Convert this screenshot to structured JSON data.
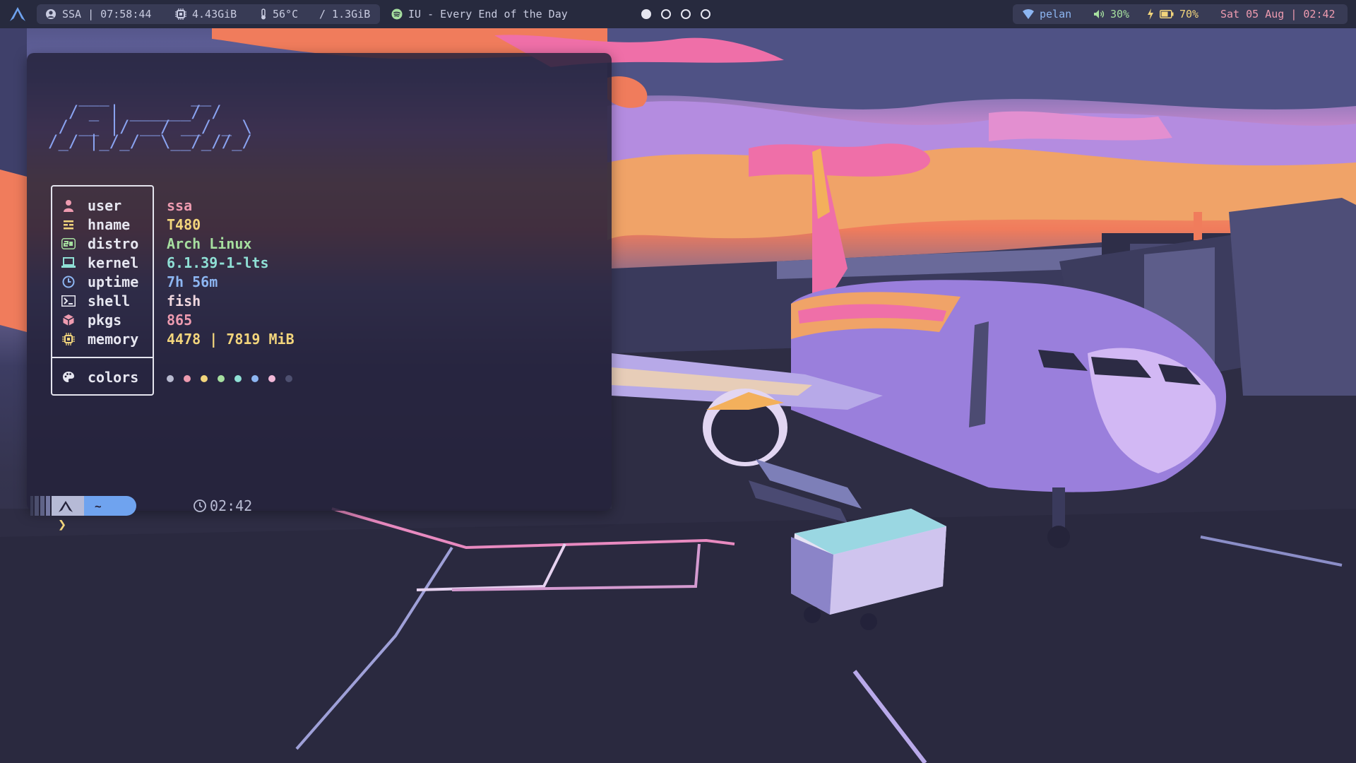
{
  "topbar": {
    "user_block": "SSA | 07:58:44",
    "memory": "4.43GiB",
    "temperature": "56°C",
    "disk": "/ 1.3GiB",
    "media": "IU - Every End of the Day",
    "workspaces": [
      {
        "active": true
      },
      {
        "active": false
      },
      {
        "active": false
      },
      {
        "active": false
      }
    ],
    "network": "pelan",
    "volume": "30%",
    "battery": "70%",
    "datetime": "Sat 05 Aug | 02:42"
  },
  "fetch": {
    "ascii_art": "   ___        __\n  / _ | ______/ /\n / __ |/ __/ __/ _ \\\n/_/ |_/_/  \\__/_//_/",
    "rows": [
      {
        "icon": "user-icon",
        "key": "user",
        "value": "ssa",
        "color": "#ee9bb0"
      },
      {
        "icon": "hostname-icon",
        "key": "hname",
        "value": "T480",
        "color": "#f2d57c"
      },
      {
        "icon": "distro-icon",
        "key": "distro",
        "value": "Arch Linux",
        "color": "#a6df9f"
      },
      {
        "icon": "laptop-icon",
        "key": "kernel",
        "value": "6.1.39-1-lts",
        "color": "#8fe0d5"
      },
      {
        "icon": "clock-icon",
        "key": "uptime",
        "value": "7h 56m",
        "color": "#8db6f2"
      },
      {
        "icon": "terminal-icon",
        "key": "shell",
        "value": "fish",
        "color": "#efd7df"
      },
      {
        "icon": "package-icon",
        "key": "pkgs",
        "value": "865",
        "color": "#ee9bb0"
      },
      {
        "icon": "chip-icon",
        "key": "memory",
        "value": "4478 | 7819 MiB",
        "color": "#f2d57c"
      }
    ],
    "colors_label": "colors",
    "palette": [
      "#b8bad0",
      "#ee9bb0",
      "#f2d57c",
      "#a6df9f",
      "#8fe0d5",
      "#8db6f2",
      "#f2b8d8",
      "#4e5070"
    ]
  },
  "prompt": {
    "dir": "~",
    "time": "02:42",
    "caret": "❯"
  },
  "colors": {
    "accent": "#8aa3f0",
    "bar_bg": "#272a3e",
    "terminal_bg": "#24223a"
  }
}
